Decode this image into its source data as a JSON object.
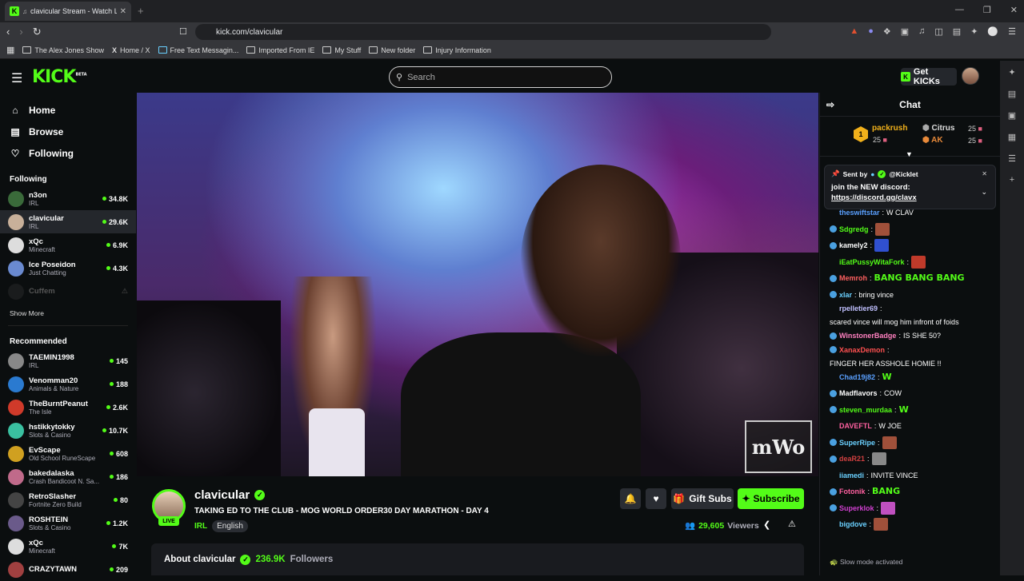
{
  "browser": {
    "tab_title": "clavicular Stream - Watch Live",
    "new_tab": "+",
    "url": "kick.com/clavicular",
    "bookmarks": [
      "The Alex Jones Show",
      "Home / X",
      "Free Text Messagin...",
      "Imported From IE",
      "My Stuff",
      "New folder",
      "Injury Information"
    ]
  },
  "header": {
    "logo": "KICK",
    "logo_beta": "BETA",
    "search_placeholder": "Search",
    "get_kicks": "Get KICKs"
  },
  "sidebar": {
    "nav": [
      {
        "label": "Home",
        "icon": "home-icon"
      },
      {
        "label": "Browse",
        "icon": "browse-icon"
      },
      {
        "label": "Following",
        "icon": "heart-icon"
      }
    ],
    "following_title": "Following",
    "following": [
      {
        "name": "n3on",
        "category": "IRL",
        "viewers": "34.8K",
        "color": "#3a6a3a"
      },
      {
        "name": "clavicular",
        "category": "IRL",
        "viewers": "29.6K",
        "color": "#c8b09a",
        "active": true
      },
      {
        "name": "xQc",
        "category": "Minecraft",
        "viewers": "6.9K",
        "color": "#dddddd"
      },
      {
        "name": "Ice Poseidon",
        "category": "Just Chatting",
        "viewers": "4.3K",
        "color": "#6a8ad0"
      },
      {
        "name": "Cuffem",
        "category": "",
        "viewers": "",
        "color": "#333333",
        "offline": true
      }
    ],
    "show_more": "Show More",
    "recommended_title": "Recommended",
    "recommended": [
      {
        "name": "TAEMIN1998",
        "category": "IRL",
        "viewers": "145",
        "color": "#888888"
      },
      {
        "name": "Venomman20",
        "category": "Animals & Nature",
        "viewers": "188",
        "color": "#2a7ad0"
      },
      {
        "name": "TheBurntPeanut",
        "category": "The Isle",
        "viewers": "2.6K",
        "color": "#d03a2a"
      },
      {
        "name": "hstikkytokky",
        "category": "Slots & Casino",
        "viewers": "10.7K",
        "color": "#3ac0a0"
      },
      {
        "name": "EvScape",
        "category": "Old School RuneScape",
        "viewers": "608",
        "color": "#d0a020"
      },
      {
        "name": "bakedalaska",
        "category": "Crash Bandicoot N. Sa...",
        "viewers": "186",
        "color": "#c06a8a"
      },
      {
        "name": "RetroSlasher",
        "category": "Fortnite Zero Build",
        "viewers": "80",
        "color": "#444444"
      },
      {
        "name": "ROSHTEIN",
        "category": "Slots & Casino",
        "viewers": "1.2K",
        "color": "#6a5a8a"
      },
      {
        "name": "xQc",
        "category": "Minecraft",
        "viewers": "7K",
        "color": "#dddddd"
      },
      {
        "name": "CRAZYTAWN",
        "category": "",
        "viewers": "209",
        "color": "#a04040"
      }
    ]
  },
  "video": {
    "watermark": "mWo"
  },
  "channel": {
    "name": "clavicular",
    "live": "LIVE",
    "title": "TAKING ED TO THE CLUB - MOG WORLD ORDER30 DAY MARATHON - DAY 4",
    "category": "IRL",
    "tag": "English",
    "gift_subs": "Gift Subs",
    "subscribe": "Subscribe",
    "viewers": "29,605",
    "viewers_label": "Viewers",
    "about": "About clavicular",
    "followers": "236.9K",
    "followers_label": "Followers"
  },
  "chat": {
    "title": "Chat",
    "leaderboard": [
      {
        "rank": "1",
        "name": "packrush",
        "value": "25"
      },
      {
        "name": "Citrus",
        "value": "25"
      },
      {
        "name": "AK",
        "value": "25"
      }
    ],
    "pinned": {
      "sent_by": "Sent by",
      "sender": "@Kicklet",
      "text": "join the NEW discord:",
      "link": "https://discord.gg/clavx"
    },
    "messages": [
      {
        "user": "theswiftstar",
        "color": "#5aa0ff",
        "text": "W CLAV"
      },
      {
        "user": "Sdgredg",
        "color": "#53fc18",
        "text": "",
        "emote": "#a0503a"
      },
      {
        "user": "kamely2",
        "color": "#ffffff",
        "text": "",
        "emote": "#3050d0"
      },
      {
        "user": "iEatPussyWitaFork",
        "color": "#53fc18",
        "text": "",
        "emote": "#c03a2a"
      },
      {
        "user": "Memroh",
        "color": "#ff6060",
        "text": "",
        "emote_text": "BANG BANG BANG"
      },
      {
        "user": "xlar",
        "color": "#6ad0ff",
        "text": "bring vince"
      },
      {
        "user": "rpelletier69",
        "color": "#c0c0ff",
        "text": "scared vince will mog him infront of foids"
      },
      {
        "user": "WinstonerBadge",
        "color": "#ff80c0",
        "text": "IS SHE 50?"
      },
      {
        "user": "XanaxDemon",
        "color": "#ff5050",
        "text": "FINGER HER ASSHOLE HOMIE !!"
      },
      {
        "user": "Chad19j82",
        "color": "#5aa0ff",
        "text": "",
        "emote_text": "W"
      },
      {
        "user": "Madflavors",
        "color": "#ffffff",
        "text": "COW"
      },
      {
        "user": "steven_murdaa",
        "color": "#53fc18",
        "text": "",
        "emote_text": "W"
      },
      {
        "user": "DAVEFTL",
        "color": "#ff60a0",
        "text": "W JOE"
      },
      {
        "user": "SuperRipe",
        "color": "#6ad0ff",
        "text": "",
        "emote": "#a0503a"
      },
      {
        "user": "deaR21",
        "color": "#d04040",
        "text": "",
        "emote": "#888888"
      },
      {
        "user": "iiamedi",
        "color": "#6ad0ff",
        "text": "INVITE VINCE"
      },
      {
        "user": "Fotonik",
        "color": "#ff60a0",
        "text": "",
        "emote_text": "BANG"
      },
      {
        "user": "Superklok",
        "color": "#d040d0",
        "text": "",
        "emote": "#c050c0"
      },
      {
        "user": "bigdove",
        "color": "#6ad0ff",
        "text": "",
        "emote": "#a0503a"
      }
    ],
    "slow_mode": "Slow mode activated"
  }
}
